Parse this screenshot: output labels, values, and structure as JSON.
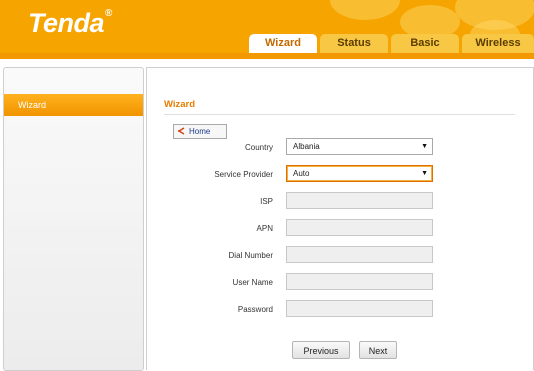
{
  "brand": {
    "logo_text": "Tenda",
    "logo_mark": "®"
  },
  "tabs": [
    {
      "label": "Wizard",
      "active": true
    },
    {
      "label": "Status",
      "active": false
    },
    {
      "label": "Basic",
      "active": false
    },
    {
      "label": "Wireless",
      "active": false
    }
  ],
  "sidebar": {
    "items": [
      {
        "label": "Wizard",
        "active": true
      }
    ]
  },
  "main": {
    "title": "Wizard",
    "home_label": "Home",
    "fields": {
      "country": {
        "label": "Country",
        "value": "Albania"
      },
      "service_provider": {
        "label": "Service Provider",
        "value": "Auto"
      },
      "isp": {
        "label": "ISP",
        "value": ""
      },
      "apn": {
        "label": "APN",
        "value": ""
      },
      "dial_number": {
        "label": "Dial Number",
        "value": ""
      },
      "user_name": {
        "label": "User Name",
        "value": ""
      },
      "password": {
        "label": "Password",
        "value": ""
      }
    },
    "buttons": {
      "previous": "Previous",
      "next": "Next"
    },
    "dropdown_arrow": "▼"
  },
  "colors": {
    "header": "#f5a400",
    "accent": "#e67e00",
    "tab_inactive": "#f8c845"
  }
}
